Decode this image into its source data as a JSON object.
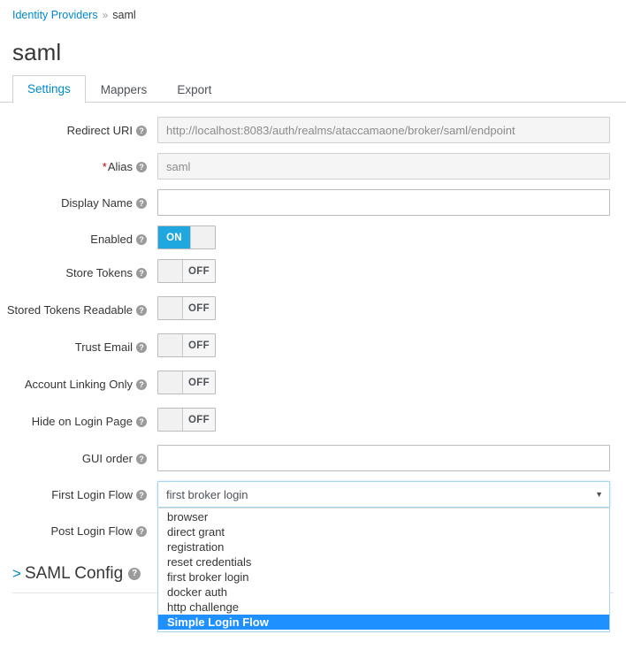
{
  "breadcrumb": {
    "parent_label": "Identity Providers",
    "separator": "»",
    "current_label": "saml"
  },
  "page_title": "saml",
  "tabs": [
    {
      "label": "Settings",
      "active": true
    },
    {
      "label": "Mappers",
      "active": false
    },
    {
      "label": "Export",
      "active": false
    }
  ],
  "help_glyph": "?",
  "required_marker": "*",
  "fields": {
    "redirect_uri": {
      "label": "Redirect URI",
      "value": "http://localhost:8083/auth/realms/ataccamaone/broker/saml/endpoint",
      "disabled": true
    },
    "alias": {
      "label": "Alias",
      "value": "saml",
      "disabled": true,
      "required": true
    },
    "display_name": {
      "label": "Display Name",
      "value": "",
      "placeholder": ""
    },
    "enabled": {
      "label": "Enabled",
      "state": "ON"
    },
    "store_tokens": {
      "label": "Store Tokens",
      "state": "OFF"
    },
    "stored_tokens_readable": {
      "label": "Stored Tokens Readable",
      "state": "OFF"
    },
    "trust_email": {
      "label": "Trust Email",
      "state": "OFF"
    },
    "account_linking_only": {
      "label": "Account Linking Only",
      "state": "OFF"
    },
    "hide_on_login_page": {
      "label": "Hide on Login Page",
      "state": "OFF"
    },
    "gui_order": {
      "label": "GUI order",
      "value": "",
      "placeholder": ""
    },
    "first_login_flow": {
      "label": "First Login Flow",
      "value": "first broker login",
      "caret": "▼",
      "expanded": true,
      "options": [
        {
          "label": "browser",
          "selected": false
        },
        {
          "label": "direct grant",
          "selected": false
        },
        {
          "label": "registration",
          "selected": false
        },
        {
          "label": "reset credentials",
          "selected": false
        },
        {
          "label": "first broker login",
          "selected": false
        },
        {
          "label": "docker auth",
          "selected": false
        },
        {
          "label": "http challenge",
          "selected": false
        },
        {
          "label": "Simple Login Flow",
          "selected": true
        }
      ]
    },
    "post_login_flow": {
      "label": "Post Login Flow"
    }
  },
  "saml_config_section": {
    "chevron": ">",
    "label": "SAML Config"
  },
  "colors": {
    "link": "#0088ce",
    "toggle_on": "#1fa7e0",
    "option_selected": "#1e90ff",
    "required": "#cc0000"
  }
}
